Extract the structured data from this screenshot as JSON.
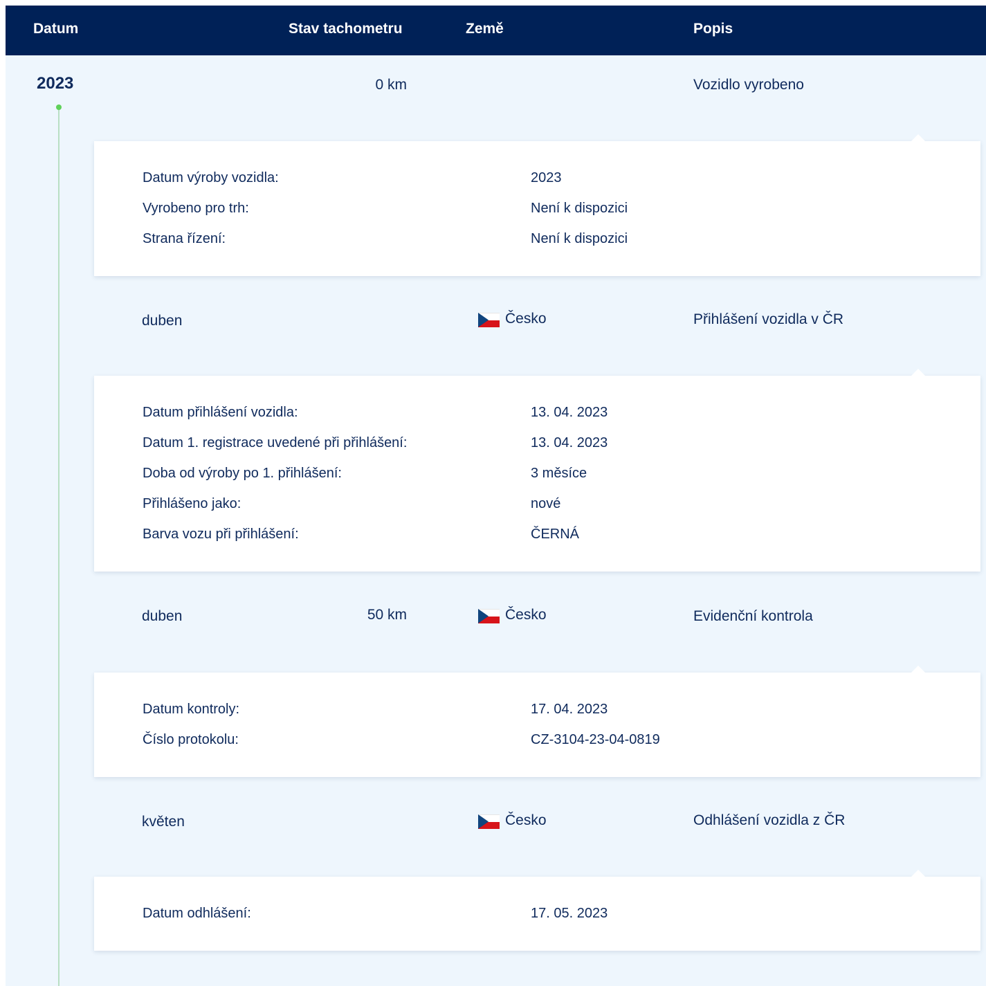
{
  "header": {
    "datum": "Datum",
    "stav_tachometru": "Stav tachometru",
    "zeme": "Země",
    "popis": "Popis"
  },
  "year": "2023",
  "events": [
    {
      "date": "",
      "odometer": "0 km",
      "country": "",
      "description": "Vozidlo vyrobeno",
      "details": [
        {
          "label": "Datum výroby vozidla:",
          "value": "2023"
        },
        {
          "label": "Vyrobeno pro trh:",
          "value": "Není k dispozici"
        },
        {
          "label": "Strana řízení:",
          "value": "Není k dispozici"
        }
      ]
    },
    {
      "date": "duben",
      "odometer": "",
      "country": "Česko",
      "description": "Přihlášení vozidla v ČR",
      "details": [
        {
          "label": "Datum přihlášení vozidla:",
          "value": "13. 04. 2023"
        },
        {
          "label": "Datum 1. registrace uvedené při přihlášení:",
          "value": "13. 04. 2023"
        },
        {
          "label": "Doba od výroby po 1. přihlášení:",
          "value": "3 měsíce"
        },
        {
          "label": "Přihlášeno jako:",
          "value": "nové"
        },
        {
          "label": "Barva vozu při přihlášení:",
          "value": "ČERNÁ"
        }
      ]
    },
    {
      "date": "duben",
      "odometer": "50 km",
      "country": "Česko",
      "description": "Evidenční kontrola",
      "details": [
        {
          "label": "Datum kontroly:",
          "value": "17. 04. 2023"
        },
        {
          "label": "Číslo protokolu:",
          "value": "CZ-3104-23-04-0819"
        }
      ]
    },
    {
      "date": "květen",
      "odometer": "",
      "country": "Česko",
      "description": "Odhlášení vozidla z ČR",
      "details": [
        {
          "label": "Datum odhlášení:",
          "value": "17. 05. 2023"
        }
      ]
    }
  ],
  "colors": {
    "header_bg": "#002157",
    "page_bg": "#eef6fd",
    "text": "#0f2a5c",
    "timeline_dot": "#5fd15a"
  }
}
